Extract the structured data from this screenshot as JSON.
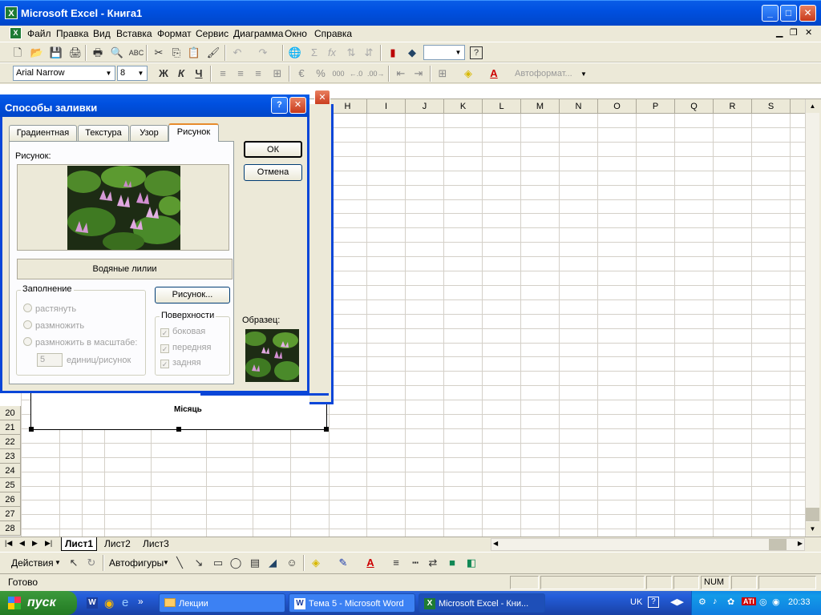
{
  "window": {
    "title": "Microsoft Excel - Книга1",
    "app_icon": "X"
  },
  "menu": {
    "items": [
      "Файл",
      "Правка",
      "Вид",
      "Вставка",
      "Формат",
      "Сервис",
      "Диаграмма",
      "Окно",
      "Справка"
    ]
  },
  "formatting": {
    "font": "Arial Narrow",
    "size": "8",
    "bold": "Ж",
    "italic": "К",
    "underline": "Ч",
    "percent": "%",
    "thousands": "000",
    "autoformat": "Автоформат..."
  },
  "columns": [
    "H",
    "I",
    "J",
    "K",
    "L",
    "M",
    "N",
    "O",
    "P",
    "Q",
    "R",
    "S"
  ],
  "rows": [
    "20",
    "21",
    "22",
    "23",
    "24",
    "25",
    "26",
    "27",
    "28"
  ],
  "chart": {
    "axis_title": "Місяць"
  },
  "sheets": {
    "tabs": [
      "Лист1",
      "Лист2",
      "Лист3"
    ],
    "active": "Лист1"
  },
  "drawing": {
    "actions": "Действия",
    "autoshapes": "Автофигуры"
  },
  "status": {
    "ready": "Готово",
    "num": "NUM"
  },
  "taskbar": {
    "start": "пуск",
    "items": [
      "Лекции",
      "Тема 5 - Microsoft Word",
      "Microsoft Excel - Кни..."
    ],
    "lang": "UK",
    "time": "20:33"
  },
  "dialog": {
    "title": "Способы заливки",
    "help": "?",
    "tabs": [
      "Градиентная",
      "Текстура",
      "Узор",
      "Рисунок"
    ],
    "active_tab": "Рисунок",
    "picture_label": "Рисунок:",
    "picture_name": "Водяные лилии",
    "fill_group": "Заполнение",
    "fill_options": [
      "растянуть",
      "размножить",
      "размножить в масштабе:"
    ],
    "scale_value": "5",
    "scale_unit": "единиц/рисунок",
    "select_picture_button": "Рисунок...",
    "surfaces_group": "Поверхности",
    "surfaces": [
      "боковая",
      "передняя",
      "задняя"
    ],
    "sample_label": "Образец:",
    "ok": "ОК",
    "cancel": "Отмена"
  }
}
